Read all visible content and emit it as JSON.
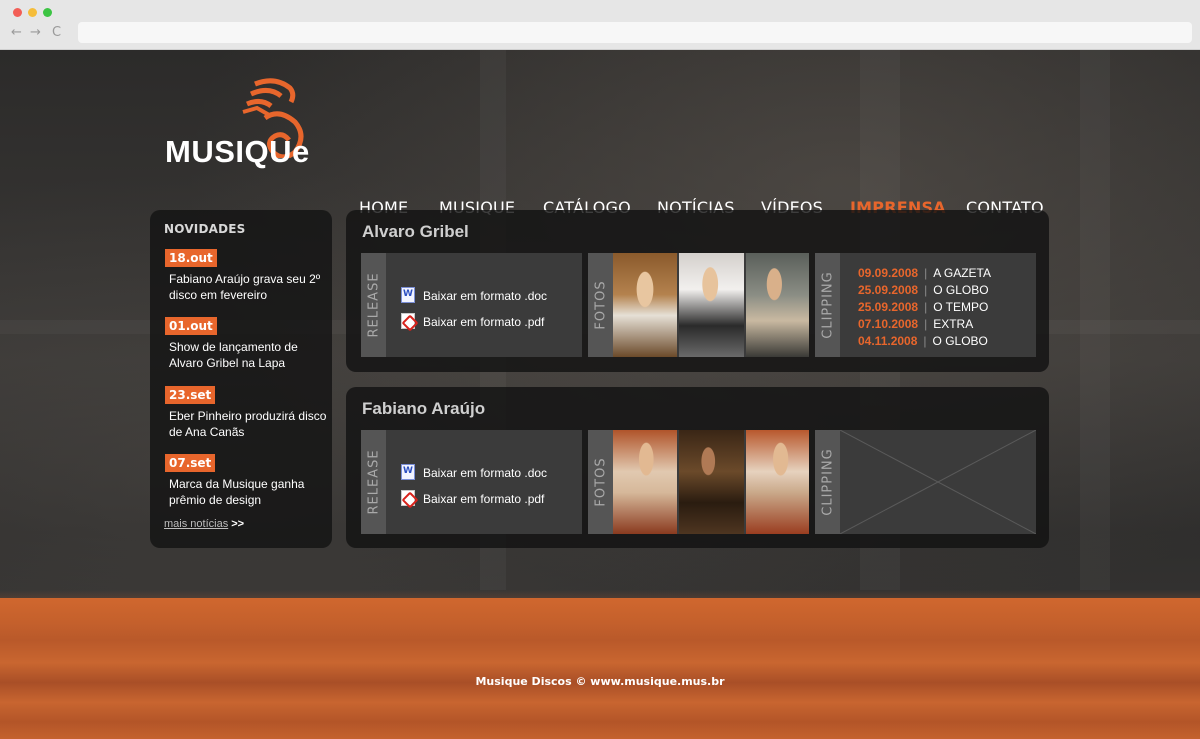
{
  "browser": {
    "back_glyph": "←",
    "forward_glyph": "→",
    "reload_glyph": "C"
  },
  "logo": {
    "text": "MUSIQUe"
  },
  "nav": {
    "items": [
      {
        "label": "HOME",
        "active": false
      },
      {
        "label": "MUSIQUE",
        "active": false
      },
      {
        "label": "CATÁLOGO",
        "active": false
      },
      {
        "label": "NOTÍCIAS",
        "active": false
      },
      {
        "label": "VÍDEOS",
        "active": false
      },
      {
        "label": "IMPRENSA",
        "active": true
      },
      {
        "label": "CONTATO",
        "active": false
      }
    ]
  },
  "sidebar": {
    "title": "NOVIDADES",
    "news": [
      {
        "date": "18.out",
        "text": "Fabiano Araújo grava seu 2º disco em fevereiro"
      },
      {
        "date": "01.out",
        "text": "Show de lançamento de Alvaro Gribel na Lapa"
      },
      {
        "date": "23.set",
        "text": "Eber Pinheiro produzirá disco de  Ana Canãs"
      },
      {
        "date": "07.set",
        "text": "Marca da Musique ganha prêmio de design"
      }
    ],
    "more_label": "mais notícias",
    "more_arrow": ">>"
  },
  "tabs": {
    "release": "RELEASE",
    "fotos": "FOTOS",
    "clipping": "CLIPPING"
  },
  "artists": [
    {
      "name": "Alvaro Gribel",
      "downloads": {
        "doc": "Baixar em formato .doc",
        "pdf": "Baixar em formato .pdf"
      },
      "clipping": [
        {
          "date": "09.09.2008",
          "source": "A GAZETA"
        },
        {
          "date": "25.09.2008",
          "source": "O GLOBO"
        },
        {
          "date": "25.09.2008",
          "source": "O TEMPO"
        },
        {
          "date": "07.10.2008",
          "source": "EXTRA"
        },
        {
          "date": "04.11.2008",
          "source": "O GLOBO"
        }
      ]
    },
    {
      "name": "Fabiano Araújo",
      "downloads": {
        "doc": "Baixar em formato .doc",
        "pdf": "Baixar em formato .pdf"
      },
      "clipping": []
    }
  ],
  "footer": {
    "text": "Musique Discos © www.musique.mus.br"
  },
  "colors": {
    "accent": "#e8662c",
    "panel": "#121212",
    "box": "#3b3b3b",
    "tab": "#555555"
  }
}
